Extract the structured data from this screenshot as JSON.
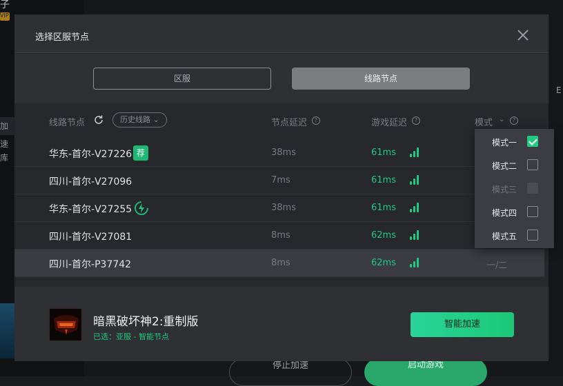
{
  "background": {
    "sidebar_fragment_top": "子",
    "sidebar_fragment_badge": "VIP",
    "sidebar_fragment_mid": "加速",
    "sidebar_fragment_low": "库",
    "right_fragment": "E",
    "stop_button": "停止加速",
    "start_button": "启动游戏"
  },
  "dialog": {
    "title": "选择区服节点"
  },
  "tabs": {
    "region": "区服",
    "route_node": "线路节点"
  },
  "table": {
    "headers": {
      "route_node": "线路节点",
      "history": "历史线路",
      "node_latency": "节点延迟",
      "game_latency": "游戏延迟",
      "mode": "模式"
    },
    "rows": [
      {
        "name": "华东-首尔-V27226",
        "node_latency": "38ms",
        "game_latency": "61ms",
        "tag": "荐"
      },
      {
        "name": "四川-首尔-V27096",
        "node_latency": "7ms",
        "game_latency": "61ms"
      },
      {
        "name": "华东-首尔-V27255",
        "node_latency": "38ms",
        "game_latency": "61ms"
      },
      {
        "name": "四川-首尔-V27081",
        "node_latency": "8ms",
        "game_latency": "62ms"
      },
      {
        "name": "四川-首尔-P37742",
        "node_latency": "8ms",
        "game_latency": "62ms",
        "mode": "一/二"
      }
    ]
  },
  "mode_menu": {
    "items": [
      {
        "label": "模式一",
        "state": "checked"
      },
      {
        "label": "模式二",
        "state": "unchecked"
      },
      {
        "label": "模式三",
        "state": "disabled"
      },
      {
        "label": "模式四",
        "state": "unchecked"
      },
      {
        "label": "模式五",
        "state": "unchecked"
      }
    ]
  },
  "footer": {
    "game_title": "暗黑破坏神2:重制版",
    "selected": "已选：亚服 - 智能节点",
    "smart_button": "智能加速"
  },
  "colors": {
    "accent": "#22c982",
    "dialog_bg": "#26282c"
  }
}
